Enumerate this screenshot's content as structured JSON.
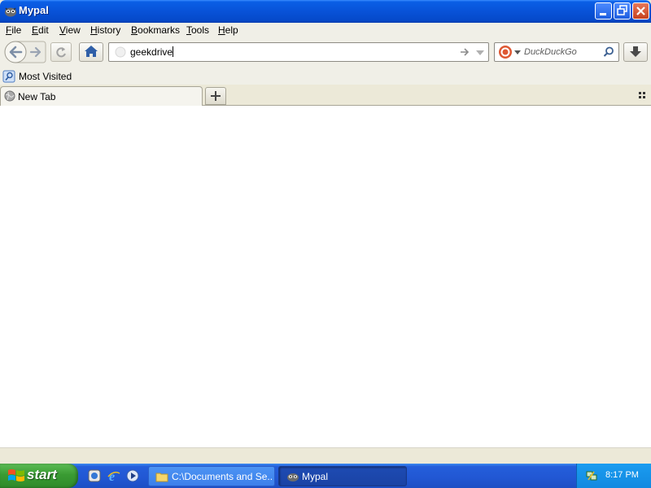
{
  "window": {
    "title": "Mypal"
  },
  "menubar": {
    "items": [
      "File",
      "Edit",
      "View",
      "History",
      "Bookmarks",
      "Tools",
      "Help"
    ]
  },
  "navbar": {
    "url_value": "geekdrive",
    "search_engine": "DuckDuckGo",
    "search_placeholder": "DuckDuckGo"
  },
  "bookmarks": {
    "items": [
      {
        "label": "Most Visited"
      }
    ]
  },
  "tabs": [
    {
      "label": "New Tab",
      "active": true
    }
  ],
  "taskbar": {
    "start_label": "start",
    "tasks": [
      {
        "label": "C:\\Documents and Se...",
        "icon": "folder-icon",
        "active": false
      },
      {
        "label": "Mypal",
        "icon": "mypal-icon",
        "active": true
      }
    ],
    "clock": "8:17 PM"
  },
  "colors": {
    "titlebar": "#0852d8",
    "taskbar": "#245edb",
    "start_button": "#3a9b33",
    "chrome": "#f0efe7"
  }
}
